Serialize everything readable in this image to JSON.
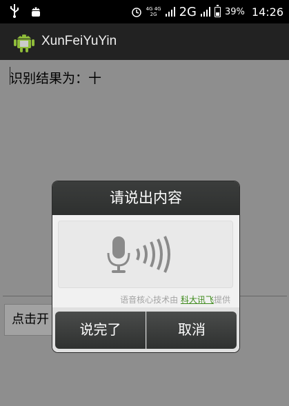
{
  "status_bar": {
    "network_small_top": "4G 4G",
    "network_small_bottom": "2G",
    "network_type": "2G",
    "battery_percent": "39%",
    "time": "14:26",
    "icons": [
      "usb-icon",
      "android-debug-icon",
      "alarm-icon",
      "signal-icon",
      "battery-icon"
    ]
  },
  "action_bar": {
    "title": "XunFeiYuYin",
    "icon": "android-app-icon"
  },
  "main": {
    "result_label": "识别结果为：十",
    "start_button_label": "点击开"
  },
  "dialog": {
    "title": "请说出内容",
    "mic_icon": "microphone-waves-icon",
    "credit_prefix": "语音核心技术由 ",
    "credit_brand": "科大讯飞",
    "credit_suffix": "提供",
    "done_label": "说完了",
    "cancel_label": "取消"
  },
  "colors": {
    "background_dim": "#8e8e8e",
    "brand_green": "#3e8a1c",
    "dialog_header": "#2e302f"
  }
}
